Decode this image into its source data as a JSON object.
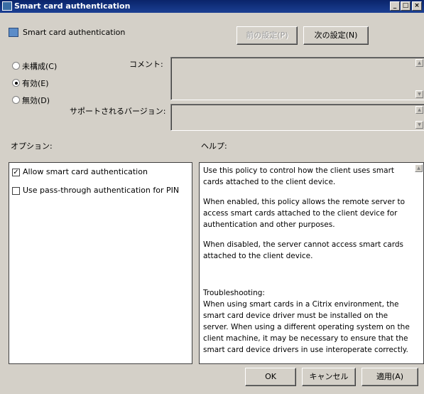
{
  "window": {
    "title": "Smart card authentication"
  },
  "header": {
    "policy_title": "Smart card authentication"
  },
  "nav": {
    "prev_label": "前の設定(P)",
    "next_label": "次の設定(N)"
  },
  "state": {
    "options": [
      {
        "label": "未構成(C)",
        "selected": false
      },
      {
        "label": "有効(E)",
        "selected": true
      },
      {
        "label": "無効(D)",
        "selected": false
      }
    ]
  },
  "comment": {
    "label": "コメント:",
    "value": ""
  },
  "version": {
    "label": "サポートされるバージョン:",
    "value": ""
  },
  "options_section": {
    "label": "オプション:",
    "items": [
      {
        "label": "Allow smart card authentication",
        "checked": true
      },
      {
        "label": "Use pass-through authentication for PIN",
        "checked": false
      }
    ]
  },
  "help": {
    "label": "ヘルプ:",
    "paragraphs": [
      "Use this policy to control how the client uses smart cards attached to the client device.",
      "When enabled, this policy allows the remote server to access smart cards attached to the client device for authentication and other purposes.",
      "When disabled, the server cannot access smart cards attached to the client device.",
      "",
      "Troubleshooting:",
      "When using smart cards in a Citrix environment, the smart card device driver must be installed on the server.  When using a different operating system on the client machine, it may be necessary to ensure that the smart card device drivers in use interoperate correctly."
    ]
  },
  "footer": {
    "ok_label": "OK",
    "cancel_label": "キャンセル",
    "apply_label": "適用(A)"
  }
}
